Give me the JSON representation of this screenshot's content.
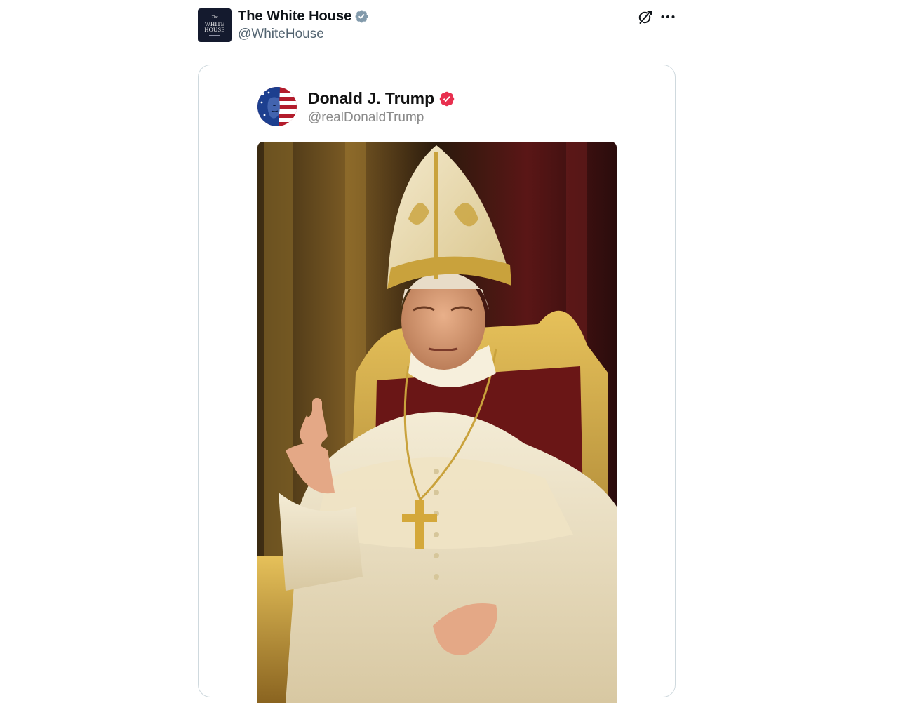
{
  "post": {
    "author": {
      "display_name": "The White House",
      "handle": "@WhiteHouse",
      "avatar_icon": "white-house-logo",
      "verified": true,
      "verified_badge_color": "#829aab"
    },
    "actions": {
      "grok_icon": "grok-icon",
      "more_icon": "more-horizontal-icon"
    },
    "quoted": {
      "platform_badge_color": "#e8304f",
      "author": {
        "display_name": "Donald J. Trump",
        "handle": "@realDonaldTrump",
        "verified": true
      },
      "media": {
        "type": "image",
        "icon": "portrait-image"
      }
    }
  },
  "colors": {
    "text_primary": "#0f1419",
    "text_secondary": "#536471",
    "card_border": "#cfd9de"
  }
}
